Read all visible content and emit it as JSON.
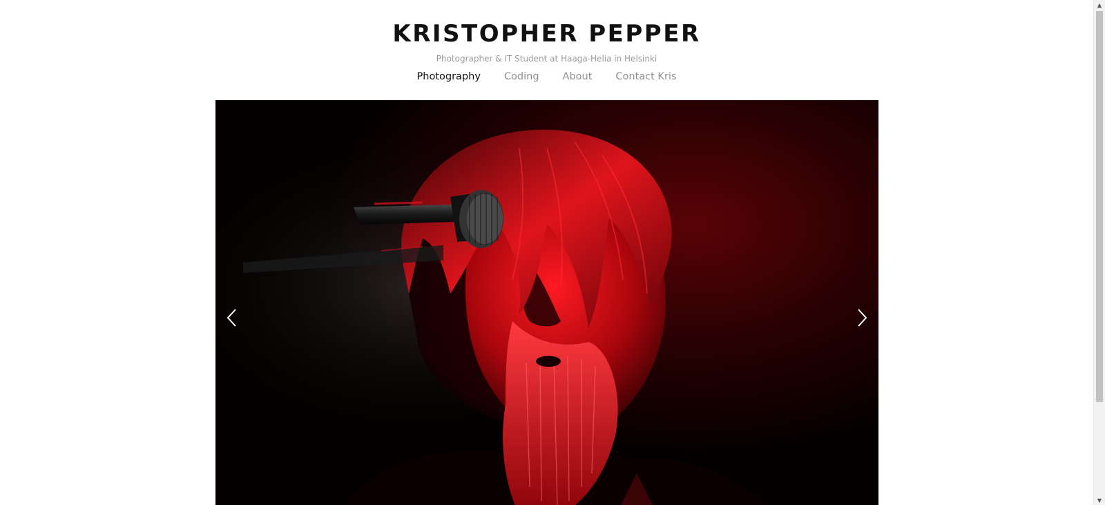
{
  "header": {
    "title": "KRISTOPHER PEPPER",
    "subtitle": "Photographer & IT Student at Haaga-Helia in Helsinki"
  },
  "nav": {
    "items": [
      {
        "label": "Photography",
        "active": true
      },
      {
        "label": "Coding",
        "active": false
      },
      {
        "label": "About",
        "active": false
      },
      {
        "label": "Contact Kris",
        "active": false
      }
    ]
  },
  "slideshow": {
    "prev_icon": "chevron-left-icon",
    "next_icon": "chevron-right-icon"
  },
  "scrollbar": {
    "up_glyph": "▲",
    "down_glyph": "▼"
  },
  "colors": {
    "title": "#111111",
    "nav_inactive": "#8f8f8f",
    "nav_active": "#111111",
    "subtitle": "#9a9a9a",
    "photo_red": "#d0101a"
  }
}
